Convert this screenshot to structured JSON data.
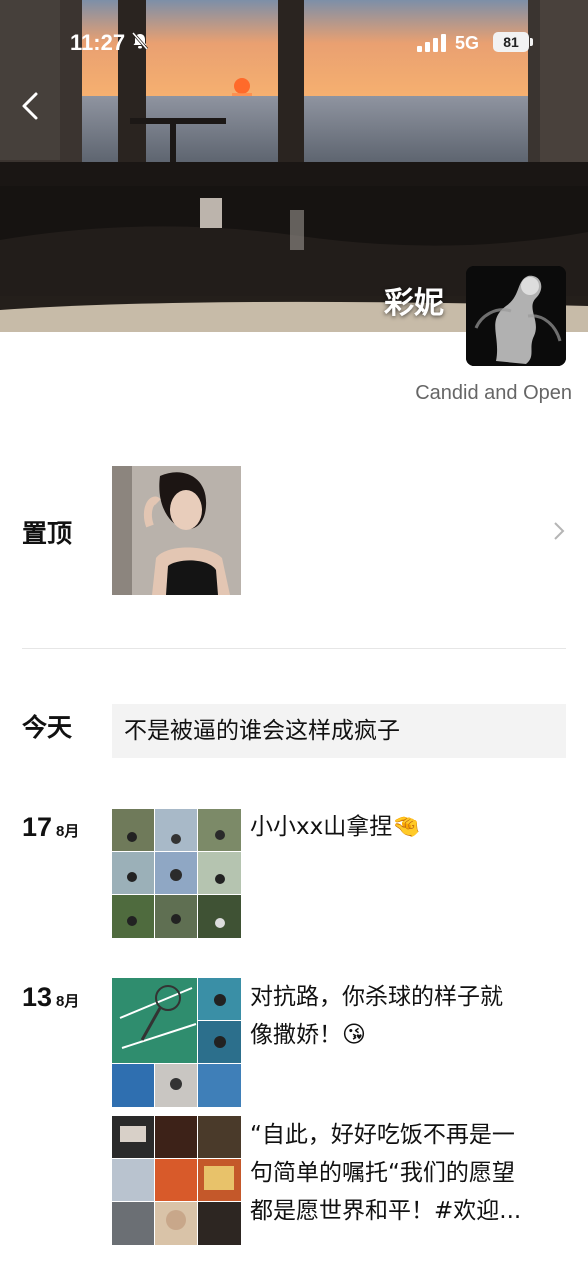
{
  "status_bar": {
    "time": "11:27",
    "network": "5G",
    "battery": "81"
  },
  "profile": {
    "name": "彩妮",
    "signature": "Candid and Open"
  },
  "pinned": {
    "label": "置顶"
  },
  "posts": [
    {
      "date_label": "今天",
      "text": "不是被逼的谁会这样成疯子"
    },
    {
      "day": "17",
      "month": "8月",
      "text": "小小xx山拿捏",
      "emoji": "🤏"
    },
    {
      "day": "13",
      "month": "8月",
      "text_line1": "对抗路，你杀球的样子就",
      "text_line2": "像撒娇！",
      "emoji": "😘"
    },
    {
      "text_line1": "“自此，好好吃饭不再是一",
      "text_line2": "句简单的嘱托“我们的愿望",
      "text_line3": "都是愿世界和平！#欢迎..."
    }
  ],
  "icons": {
    "back": "chevron-left-icon",
    "mute": "bell-slash-icon",
    "signal": "signal-bars-icon",
    "battery": "battery-icon",
    "chevron": "chevron-right-icon"
  },
  "colors": {
    "text_post_bg": "#f3f3f3",
    "signature": "#666666",
    "divider": "#e6e6e6"
  }
}
